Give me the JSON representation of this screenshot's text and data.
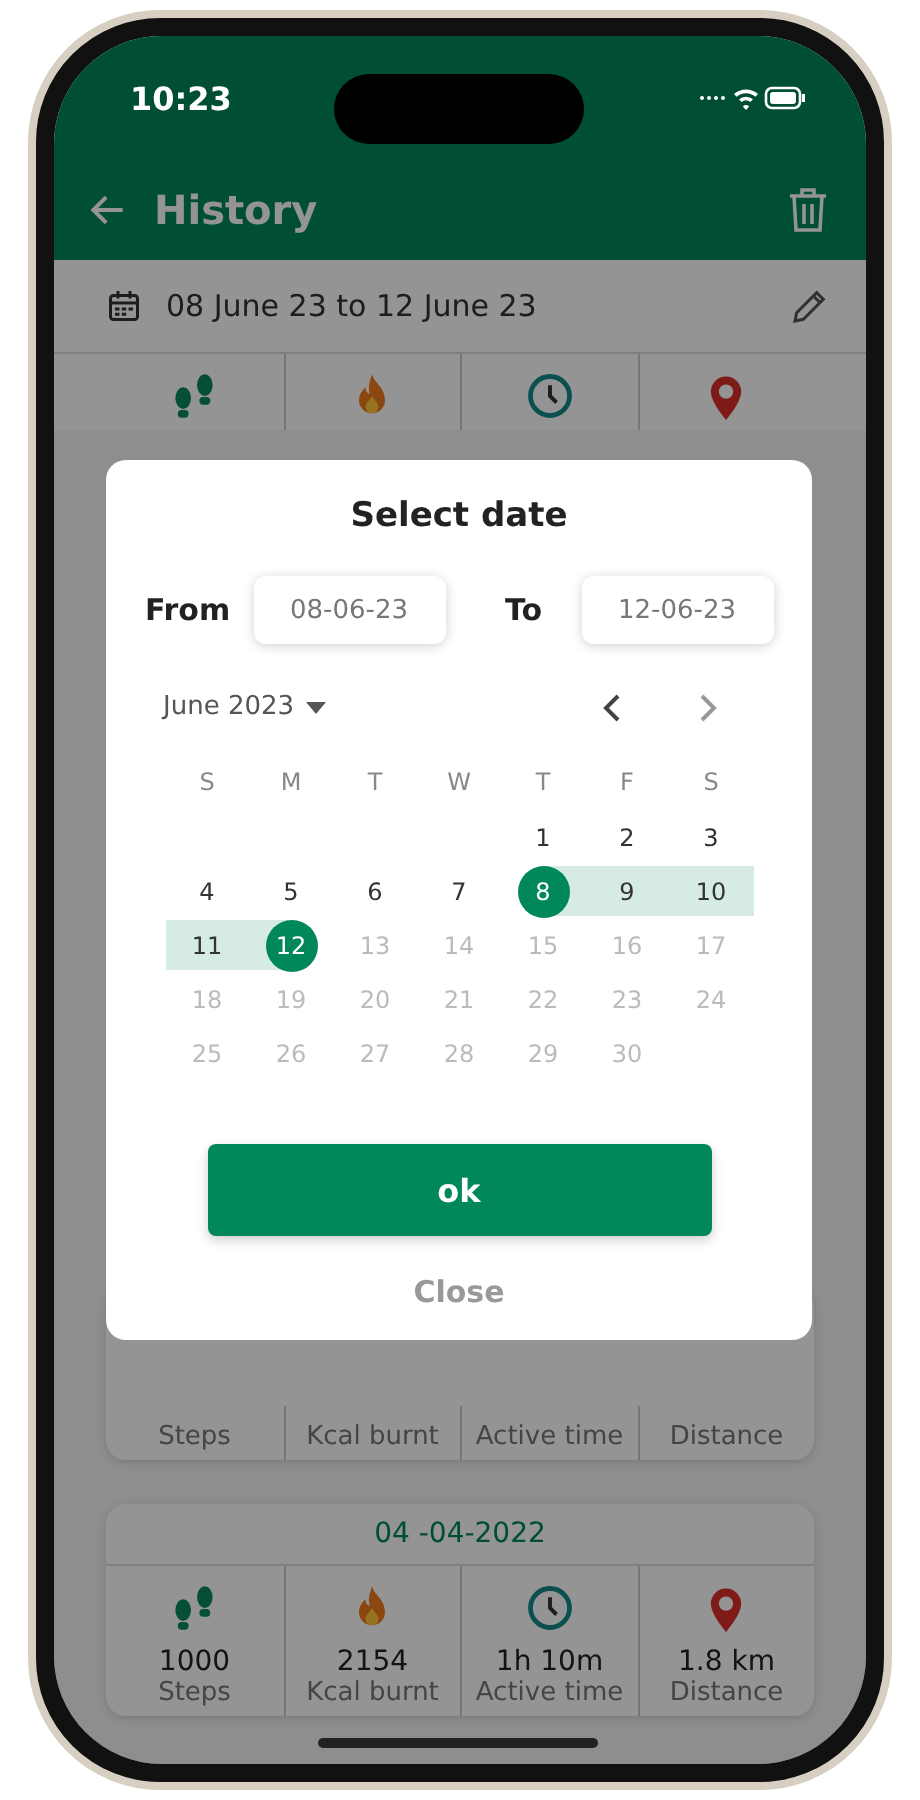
{
  "status_bar": {
    "time": "10:23"
  },
  "header": {
    "title": "History"
  },
  "date_range": {
    "text": "08 June 23 to 12 June 23"
  },
  "summary": {
    "stats": [
      {
        "kind": "steps"
      },
      {
        "kind": "calories"
      },
      {
        "kind": "time"
      },
      {
        "kind": "distance"
      }
    ]
  },
  "cards": [
    {
      "stats": [
        {
          "label": "Steps"
        },
        {
          "label": "Kcal burnt"
        },
        {
          "label": "Active time"
        },
        {
          "label": "Distance"
        }
      ]
    },
    {
      "date": "04 -04-2022",
      "stats": [
        {
          "kind": "steps",
          "value": "1000",
          "label": "Steps"
        },
        {
          "kind": "calories",
          "value": "2154",
          "label": "Kcal burnt"
        },
        {
          "kind": "time",
          "value": "1h 10m",
          "label": "Active time"
        },
        {
          "kind": "distance",
          "value": "1.8 km",
          "label": "Distance"
        }
      ]
    }
  ],
  "dialog": {
    "title": "Select date",
    "from": {
      "label": "From",
      "value": "08-06-23"
    },
    "to": {
      "label": "To",
      "value": "12-06-23"
    },
    "month": "June 2023",
    "weekdays": [
      "S",
      "M",
      "T",
      "W",
      "T",
      "F",
      "S"
    ],
    "weeks": [
      [
        {
          "kind": "blank"
        },
        {
          "kind": "blank"
        },
        {
          "kind": "blank"
        },
        {
          "kind": "blank"
        },
        {
          "kind": "day",
          "label": "1",
          "selected": false,
          "in_range": false,
          "disabled": false
        },
        {
          "label": "2",
          "selected": false,
          "in_range": false,
          "disabled": false
        },
        {
          "label": "3",
          "selected": false,
          "in_range": false,
          "disabled": false
        }
      ],
      [
        {
          "label": "4",
          "selected": false,
          "in_range": false,
          "disabled": false
        },
        {
          "label": "5",
          "selected": false,
          "in_range": false,
          "disabled": false
        },
        {
          "label": "6",
          "selected": false,
          "in_range": false,
          "disabled": false
        },
        {
          "label": "7",
          "selected": false,
          "in_range": false,
          "disabled": false
        },
        {
          "label": "8",
          "selected": true,
          "in_range": false,
          "disabled": false
        },
        {
          "label": "9",
          "selected": false,
          "in_range": true,
          "disabled": false
        },
        {
          "label": "10",
          "selected": false,
          "in_range": true,
          "disabled": false
        }
      ],
      [
        {
          "label": "11",
          "selected": false,
          "in_range": true,
          "disabled": false
        },
        {
          "label": "12",
          "selected": true,
          "in_range": false,
          "disabled": false
        },
        {
          "label": "13",
          "selected": false,
          "in_range": false,
          "disabled": true
        },
        {
          "label": "14",
          "selected": false,
          "in_range": false,
          "disabled": true
        },
        {
          "label": "15",
          "selected": false,
          "in_range": false,
          "disabled": true
        },
        {
          "label": "16",
          "selected": false,
          "in_range": false,
          "disabled": true
        },
        {
          "label": "17",
          "selected": false,
          "in_range": false,
          "disabled": true
        }
      ],
      [
        {
          "label": "18",
          "selected": false,
          "in_range": false,
          "disabled": true
        },
        {
          "label": "19",
          "selected": false,
          "in_range": false,
          "disabled": true
        },
        {
          "label": "20",
          "selected": false,
          "in_range": false,
          "disabled": true
        },
        {
          "label": "21",
          "selected": false,
          "in_range": false,
          "disabled": true
        },
        {
          "label": "22",
          "selected": false,
          "in_range": false,
          "disabled": true
        },
        {
          "label": "23",
          "selected": false,
          "in_range": false,
          "disabled": true
        },
        {
          "label": "24",
          "selected": false,
          "in_range": false,
          "disabled": true
        }
      ],
      [
        {
          "label": "25",
          "selected": false,
          "in_range": false,
          "disabled": true
        },
        {
          "label": "26",
          "selected": false,
          "in_range": false,
          "disabled": true
        },
        {
          "label": "27",
          "selected": false,
          "in_range": false,
          "disabled": true
        },
        {
          "label": "28",
          "selected": false,
          "in_range": false,
          "disabled": true
        },
        {
          "label": "29",
          "selected": false,
          "in_range": false,
          "disabled": true
        },
        {
          "label": "30",
          "selected": false,
          "in_range": false,
          "disabled": true
        },
        {
          "kind": "blank"
        }
      ]
    ],
    "ok_button": "ok",
    "close_button": "Close"
  }
}
